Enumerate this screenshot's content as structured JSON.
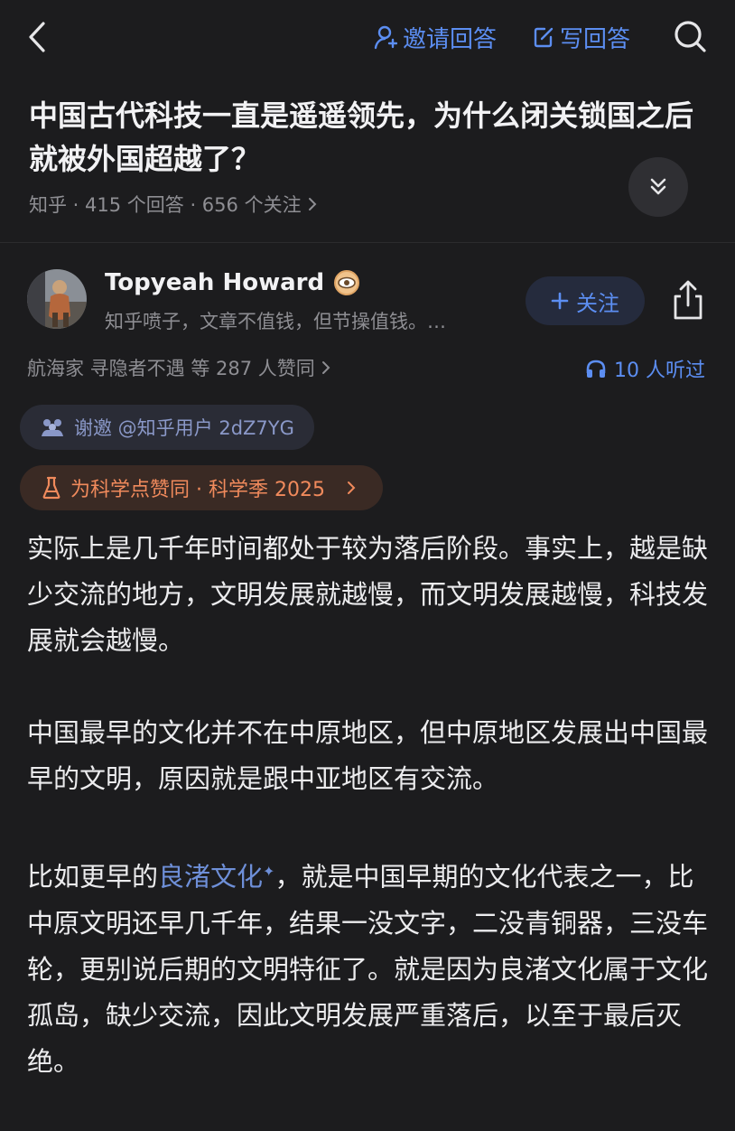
{
  "topbar": {
    "invite_label": "邀请回答",
    "write_label": "写回答"
  },
  "question": {
    "title": "中国古代科技一直是遥遥领先，为什么闭关锁国之后就被外国超越了？",
    "meta": "知乎 · 415 个回答 · 656 个关注"
  },
  "answer": {
    "author_name": "Topyeah Howard",
    "author_bio": "知乎喷子，文章不值钱，但节操值钱。…",
    "follow_label": "关注",
    "votes": "航海家 寻隐者不遇 等 287 人赞同",
    "listened": "10 人听过",
    "invite_tag": "谢邀 @知乎用户 2dZ7YG",
    "science_tag": "为科学点赞同 · 科学季 2025",
    "paragraphs": [
      "实际上是几千年时间都处于较为落后阶段。事实上，越是缺少交流的地方，文明发展就越慢，而文明发展越慢，科技发展就会越慢。",
      "中国最早的文化并不在中原地区，但中原地区发展出中国最早的文明，原因就是跟中亚地区有交流。"
    ],
    "p3_prefix": "比如更早的",
    "p3_link": "良渚文化",
    "p3_suffix": "，就是中国早期的文化代表之一，比中原文明还早几千年，结果一没文字，二没青铜器，三没车轮，更别说后期的文明特征了。就是因为良渚文化属于文化孤岛，缺少交流，因此文明发展严重落后，以至于最后灭绝。"
  },
  "colors": {
    "background": "#1c1c1e",
    "accent_blue": "#5c8ef2",
    "science_orange": "#f08a5c"
  }
}
